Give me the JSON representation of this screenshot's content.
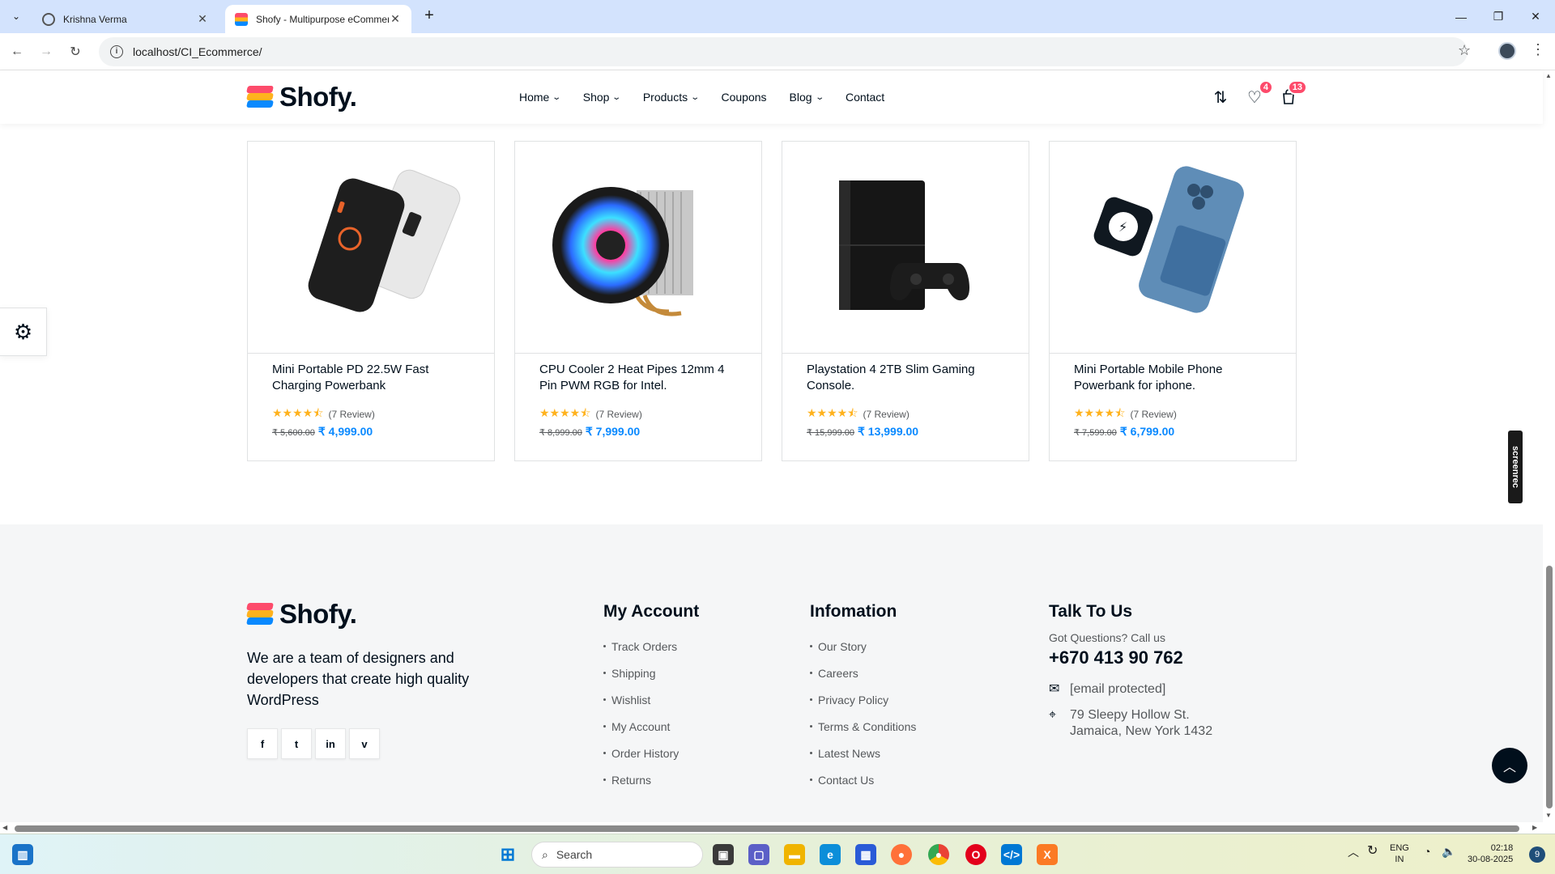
{
  "browser": {
    "tabs": [
      {
        "title": "Krishna Verma",
        "active": false
      },
      {
        "title": "Shofy - Multipurpose eCommer",
        "active": true
      }
    ],
    "url": "localhost/CI_Ecommerce/"
  },
  "site": {
    "logo_text": "Shofy.",
    "nav": [
      {
        "label": "Home",
        "dropdown": true
      },
      {
        "label": "Shop",
        "dropdown": true
      },
      {
        "label": "Products",
        "dropdown": true
      },
      {
        "label": "Coupons",
        "dropdown": false
      },
      {
        "label": "Blog",
        "dropdown": true
      },
      {
        "label": "Contact",
        "dropdown": false
      }
    ],
    "wishlist_count": "4",
    "cart_count": "13"
  },
  "products": [
    {
      "name": "Mini Portable PD 22.5W Fast Charging Powerbank",
      "rating": 4.5,
      "reviews": "(7 Review)",
      "old_price": "₹ 5,600.00",
      "price": "₹ 4,999.00"
    },
    {
      "name": "CPU Cooler 2 Heat Pipes 12mm 4 Pin PWM RGB for Intel.",
      "rating": 4.5,
      "reviews": "(7 Review)",
      "old_price": "₹ 8,999.00",
      "price": "₹ 7,999.00"
    },
    {
      "name": "Playstation 4 2TB Slim Gaming Console.",
      "rating": 4.5,
      "reviews": "(7 Review)",
      "old_price": "₹ 15,999.00",
      "price": "₹ 13,999.00"
    },
    {
      "name": "Mini Portable Mobile Phone Powerbank for iphone.",
      "rating": 4.5,
      "reviews": "(7 Review)",
      "old_price": "₹ 7,599.00",
      "price": "₹ 6,799.00"
    }
  ],
  "footer": {
    "logo_text": "Shofy.",
    "description": "We are a team of designers and developers that create high quality WordPress",
    "socials": [
      "f",
      "t",
      "in",
      "v"
    ],
    "my_account": {
      "title": "My Account",
      "links": [
        "Track Orders",
        "Shipping",
        "Wishlist",
        "My Account",
        "Order History",
        "Returns"
      ]
    },
    "information": {
      "title": "Infomation",
      "links": [
        "Our Story",
        "Careers",
        "Privacy Policy",
        "Terms & Conditions",
        "Latest News",
        "Contact Us"
      ]
    },
    "talk": {
      "title": "Talk To Us",
      "question": "Got Questions? Call us",
      "phone": "+670 413 90 762",
      "email": "[email protected]",
      "address_line1": "79 Sleepy Hollow St.",
      "address_line2": "Jamaica, New York 1432"
    }
  },
  "overlay": {
    "screenrec_label": "screenrec"
  },
  "taskbar": {
    "search_placeholder": "Search",
    "lang_line1": "ENG",
    "lang_line2": "IN",
    "time": "02:18",
    "date": "30-08-2025",
    "notifications": "9"
  },
  "colors": {
    "accent_blue": "#0989ff",
    "badge_red": "#fd4b6b",
    "star_yellow": "#ffb21d",
    "dark": "#010f1c"
  }
}
